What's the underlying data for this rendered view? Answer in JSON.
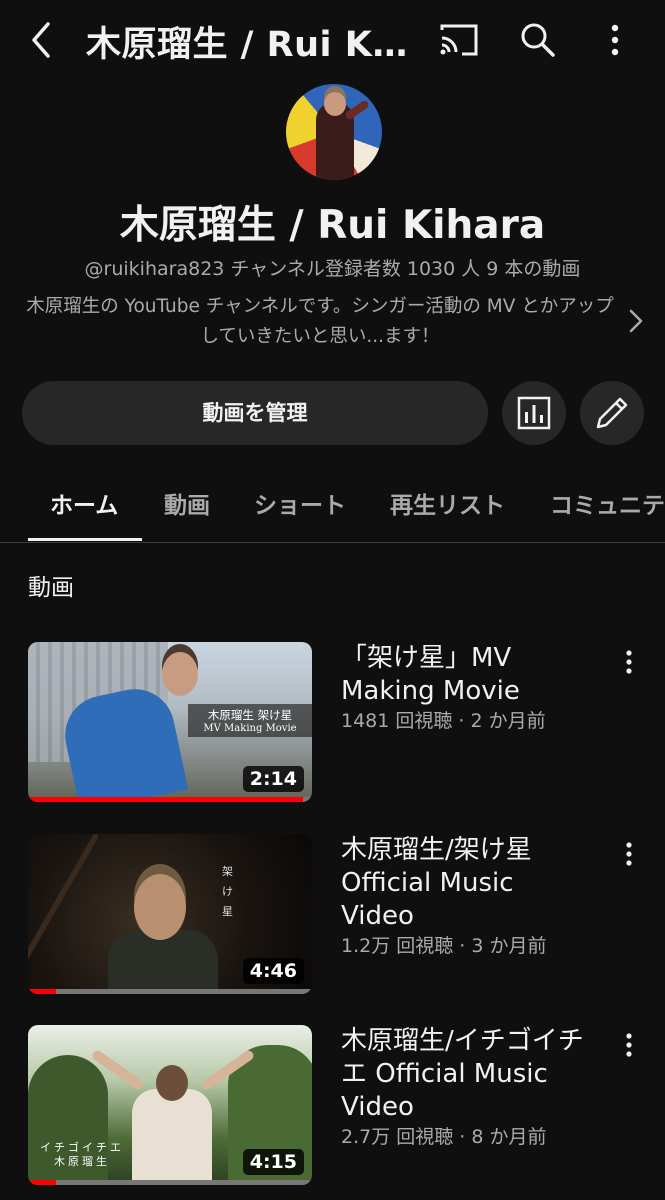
{
  "header": {
    "title": "木原瑠生 / Rui Kihara"
  },
  "channel": {
    "name": "木原瑠生 / Rui Kihara",
    "meta": "@ruikihara823  チャンネル登録者数 1030 人  9 本の動画",
    "description": "木原瑠生の YouTube チャンネルです。シンガー活動の MV とかアップしていきたいと思い...ます！"
  },
  "actions": {
    "manage_label": "動画を管理"
  },
  "tabs": [
    {
      "label": "ホーム"
    },
    {
      "label": "動画"
    },
    {
      "label": "ショート"
    },
    {
      "label": "再生リスト"
    },
    {
      "label": "コミュニテ"
    }
  ],
  "section": {
    "title": "動画"
  },
  "videos": [
    {
      "title": "「架け星」MV Making Movie",
      "meta": "1481 回視聴 · 2 か月前",
      "duration": "2:14",
      "progress": 0.97,
      "thumb_caption_1": "木原瑠生 架け星",
      "thumb_caption_2": "MV Making Movie"
    },
    {
      "title": "木原瑠生/架け星 Official Music Video",
      "meta": "1.2万 回視聴 · 3 か月前",
      "duration": "4:46",
      "progress": 0.1,
      "thumb_caption_1": "架け星"
    },
    {
      "title": "木原瑠生/イチゴイチエ Official Music Video",
      "meta": "2.7万 回視聴 · 8 か月前",
      "duration": "4:15",
      "progress": 0.1,
      "thumb_caption_1": "イチゴイチエ",
      "thumb_caption_2": "木原瑠生"
    }
  ],
  "colors": {
    "background": "#0f0f0f",
    "surface": "#272727",
    "text_primary": "#f1f1f1",
    "text_secondary": "#aaaaaa",
    "progress": "#ff0000"
  },
  "icons": [
    "back-icon",
    "cast-icon",
    "search-icon",
    "more-vert-icon",
    "chevron-right-icon",
    "analytics-icon",
    "edit-pencil-icon"
  ]
}
